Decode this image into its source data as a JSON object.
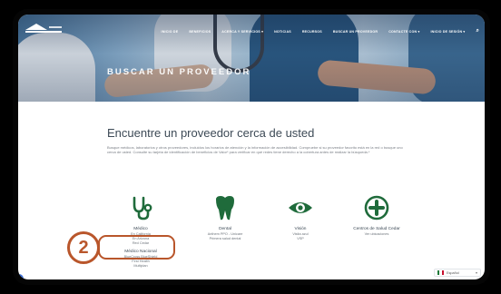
{
  "nav": {
    "items": [
      "INICIO DE",
      "BENEFICIOS",
      "ACERCA Y SERVICIOS ▾",
      "NOTICIAS",
      "RECURSOS",
      "BUSCAR UN PROVEEDOR",
      "CONTACTE CON ▾",
      "INICIO DE SESIÓN ▾"
    ],
    "search_icon": "⌕"
  },
  "hero": {
    "title": "BUSCAR UN PROVEEDOR"
  },
  "main": {
    "heading": "Encuentre un proveedor cerca de usted",
    "paragraph": "Busque médicos, laboratorios y otros proveedores, incluidos los horarios de atención y la información de accesibilidad. Compruebe si su proveedor favorito está en la red o busque uno cerca de usted. Consulte su tarjeta de identificación de beneficios de Valor* para verificar en qué redes tiene derecho a la cobertura antes de realizar la búsqueda.*"
  },
  "categories": [
    {
      "icon": "stethoscope-icon",
      "title": "Médico",
      "links": [
        "En California",
        "En Arizona",
        "Red Cedar"
      ],
      "title2": "Médico Nacional",
      "links2": [
        "BlueCross BlueShield",
        "First Health",
        "Multiplan"
      ]
    },
    {
      "icon": "tooth-icon",
      "title": "Dental",
      "links": [
        "Anthem PPO - Unicare",
        "Primera salud dental"
      ]
    },
    {
      "icon": "eye-icon",
      "title": "Visión",
      "links": [
        "Visita azul",
        "VSP"
      ]
    },
    {
      "icon": "plus-circle-icon",
      "title": "Centros de Salud Cedar",
      "links": [
        "Ver ubicaciones"
      ]
    }
  ],
  "annotation": {
    "number": "2"
  },
  "help": {
    "label": "?"
  },
  "language": {
    "label": "Español",
    "chevron": "▾"
  },
  "colors": {
    "accent": "#b9562b",
    "icon_green": "#1f6b3b",
    "heading": "#3d4a56"
  }
}
